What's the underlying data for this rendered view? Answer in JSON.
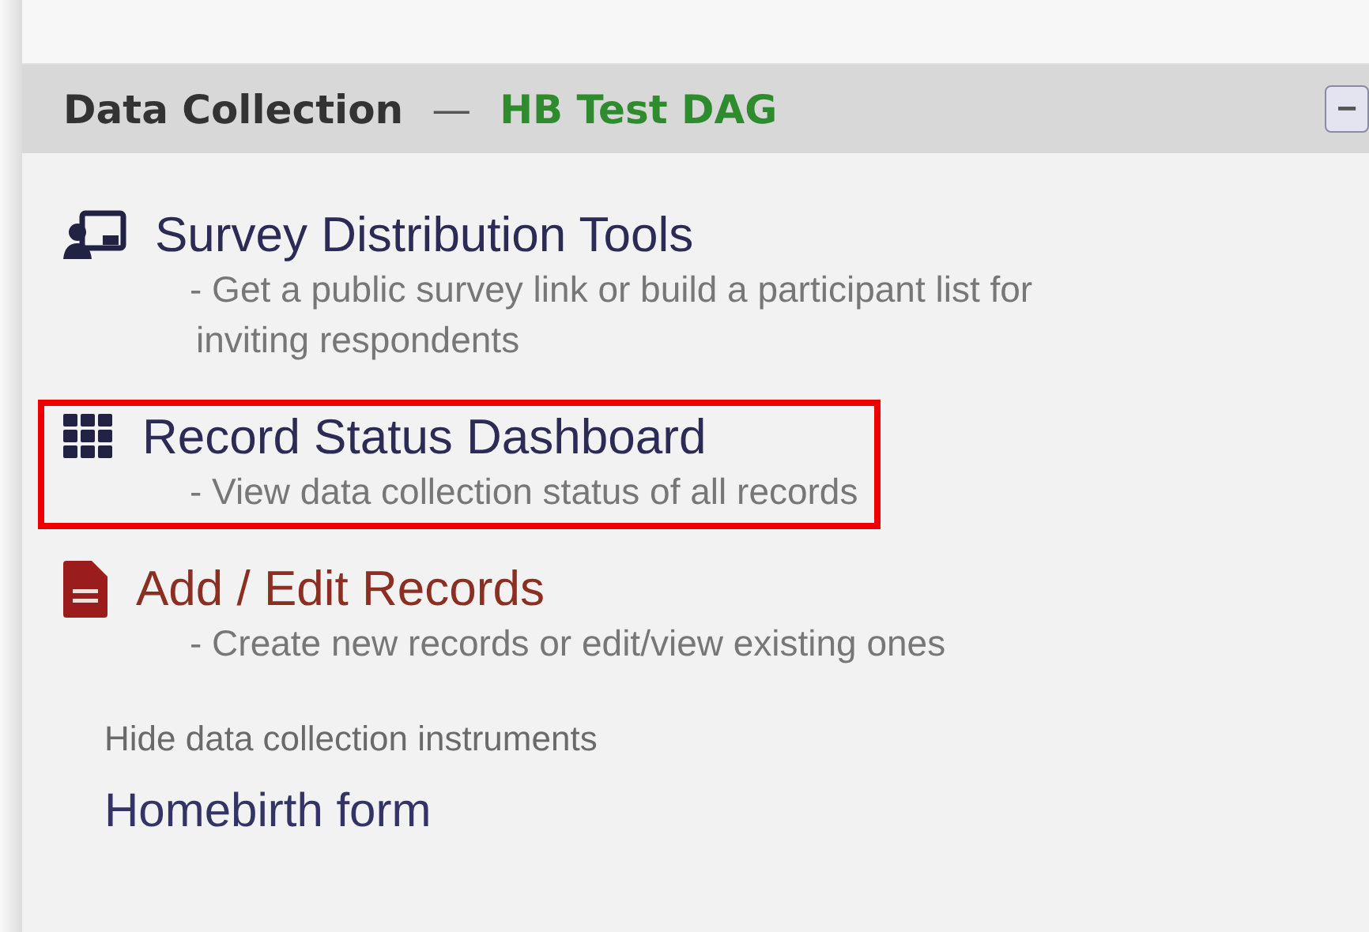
{
  "panel": {
    "title": "Data Collection",
    "separator": "—",
    "group": "HB Test DAG",
    "collapse_button": "−"
  },
  "links": [
    {
      "kind": "survey",
      "title": "Survey Distribution Tools",
      "description": "- Get a public survey link or build a participant list for inviting respondents",
      "highlighted": false
    },
    {
      "kind": "dashboard",
      "title": "Record Status Dashboard",
      "description": "- View data collection status of all records",
      "highlighted": true
    },
    {
      "kind": "records",
      "title": "Add / Edit Records",
      "description": "- Create new records or edit/view existing ones",
      "highlighted": false
    }
  ],
  "instruments_toggle": "Hide data collection instruments",
  "instruments": [
    "Homebirth form"
  ]
}
